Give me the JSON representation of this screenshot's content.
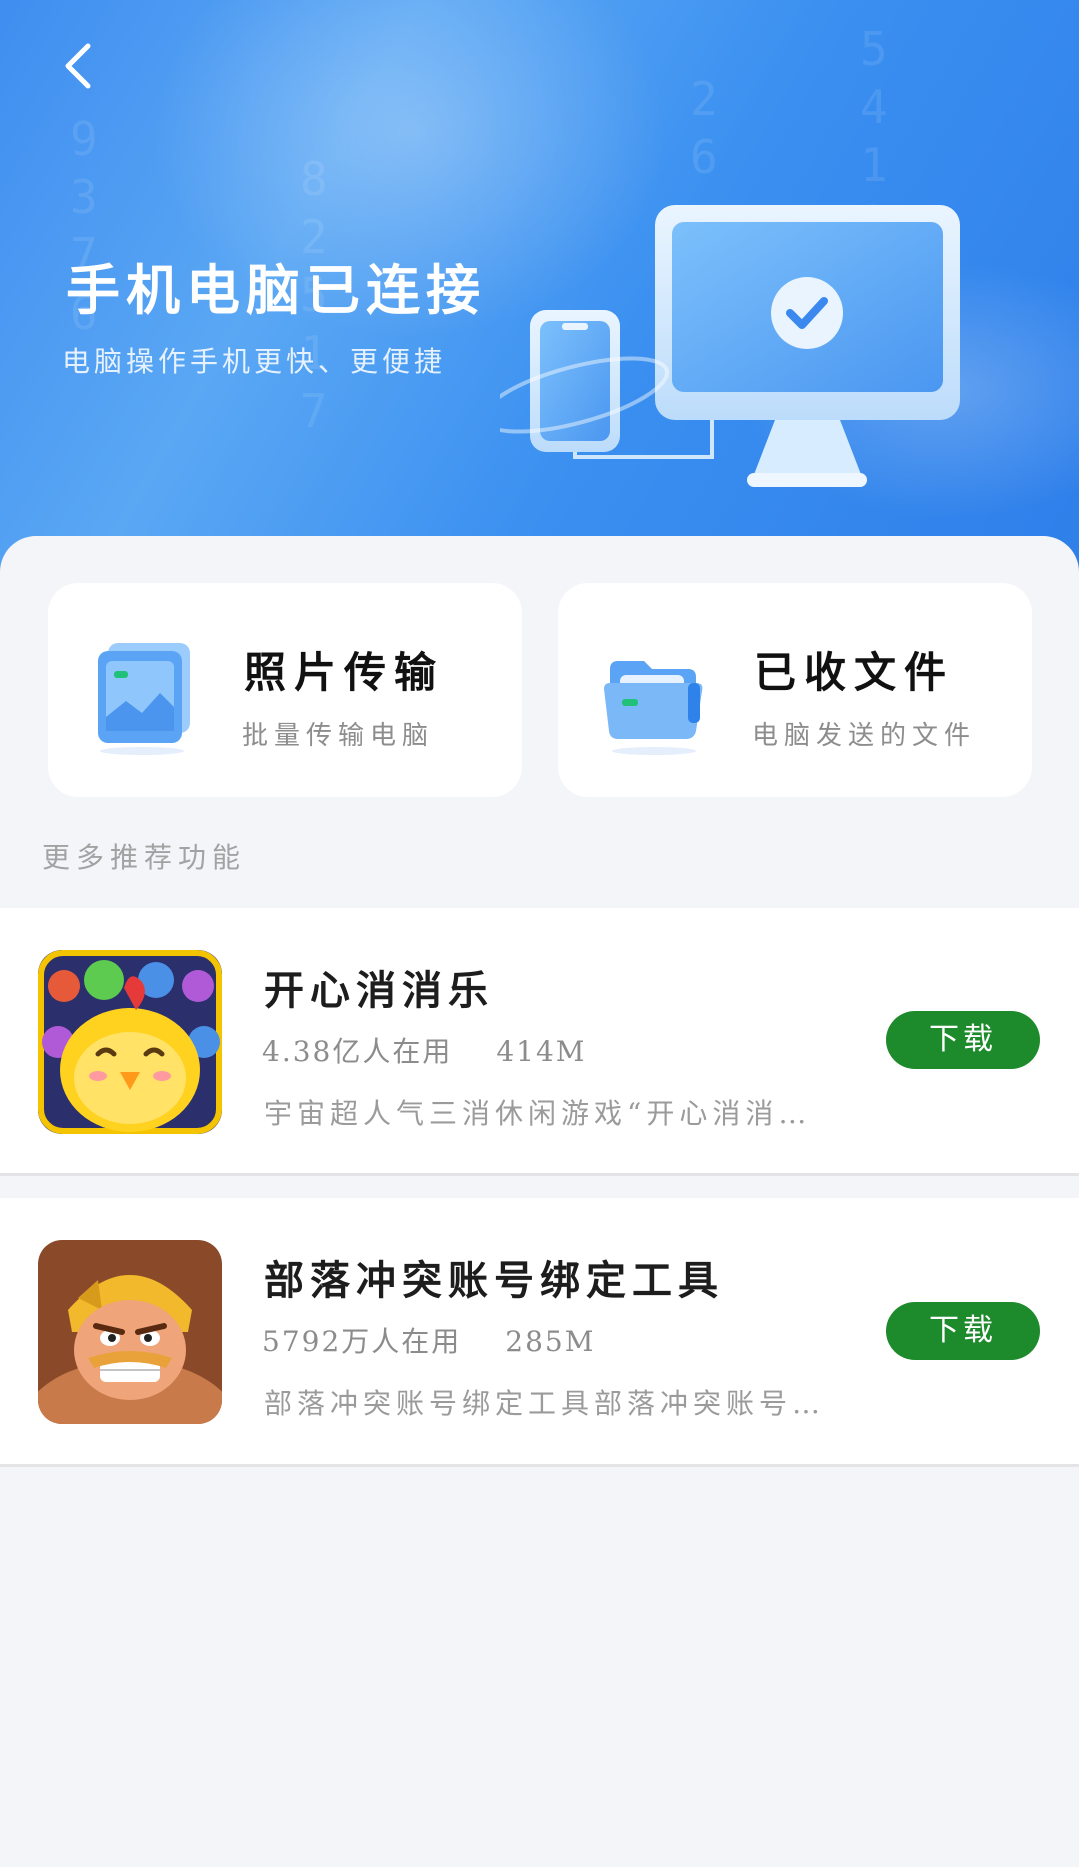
{
  "header": {
    "back_icon": "chevron-left-icon",
    "title": "手机电脑已连接",
    "subtitle": "电脑操作手机更快、更便捷",
    "illustration": "phone-monitor-connected-icon"
  },
  "cards": [
    {
      "title": "照片传输",
      "subtitle": "批量传输电脑",
      "icon": "photo-stack-icon"
    },
    {
      "title": "已收文件",
      "subtitle": "电脑发送的文件",
      "icon": "folder-icon"
    }
  ],
  "section_label": "更多推荐功能",
  "apps": [
    {
      "name": "开心消消乐",
      "users": "4.38亿人在用",
      "size": "414M",
      "description": "宇宙超人气三消休闲游戏“开心消消…",
      "button": "下载",
      "icon": "chick-game-icon"
    },
    {
      "name": "部落冲突账号绑定工具",
      "users": "5792万人在用",
      "size": "285M",
      "description": "部落冲突账号绑定工具部落冲突账号…",
      "button": "下载",
      "icon": "barbarian-game-icon"
    }
  ],
  "colors": {
    "hero_blue": "#3f8ef0",
    "download_green": "#1d8a2c",
    "background": "#f4f5f9"
  }
}
